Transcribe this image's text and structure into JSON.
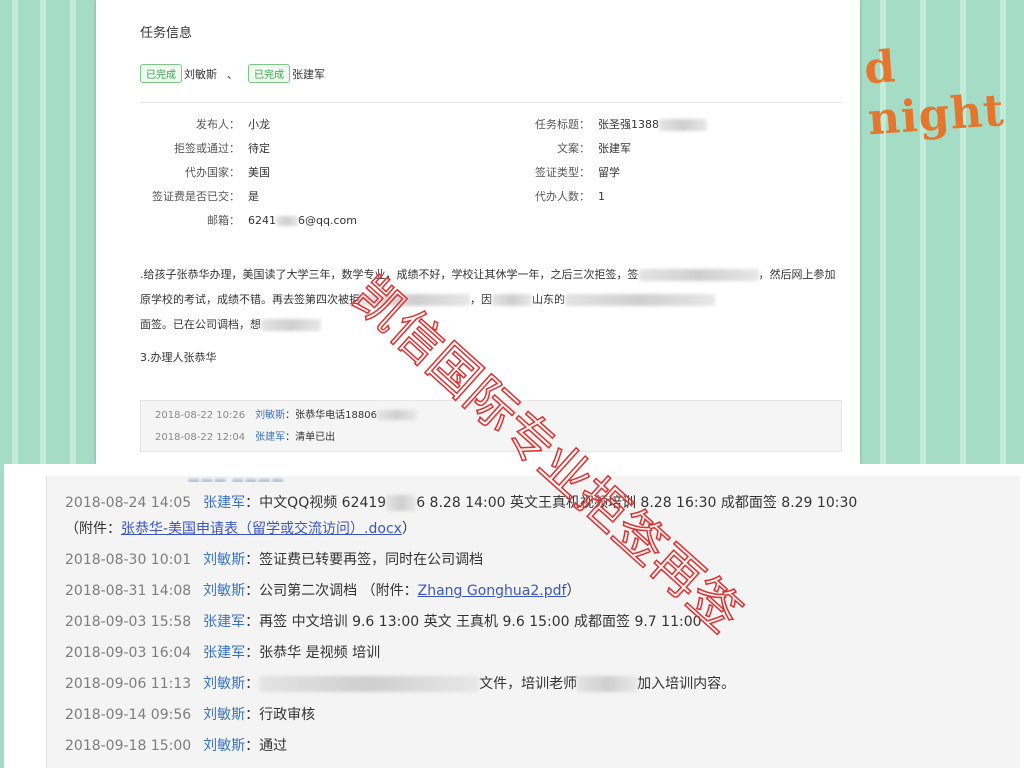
{
  "top": {
    "section_title": "任务信息",
    "assignees": [
      {
        "status": "已完成",
        "name": "刘敏斯"
      },
      {
        "status": "已完成",
        "name": "张建军"
      }
    ],
    "assignee_separator": "、",
    "fields": {
      "publisher_label": "发布人：",
      "publisher": "小龙",
      "refusal_label": "拒签或通过：",
      "refusal": "待定",
      "country_label": "代办国家：",
      "country": "美国",
      "fee_label": "签证费是否已交：",
      "fee": "是",
      "email_label": "邮箱：",
      "email_prefix": "6241",
      "email_suffix": "6@qq.com",
      "task_title_label": "任务标题：",
      "task_title": "张圣强1388",
      "copy_label": "文案：",
      "copy": "张建军",
      "visa_type_label": "签证类型：",
      "visa_type": "留学",
      "count_label": "代办人数：",
      "count": "1"
    },
    "description": [
      {
        "a": ".给孩子张恭华办理，美国读了大学三年，数学专业，成绩不好，学校让其休学一年，之后三次拒签，签",
        "b": "，然后网上参加"
      },
      {
        "a": "原学校的考试，成绩不错。再去签第四次被拒",
        "b": "，因",
        "c": "山东的"
      },
      {
        "a": "面签。已在公司调档，想"
      }
    ],
    "note": "3.办理人张恭华",
    "log": [
      {
        "date": "2018-08-22 10:26",
        "user": "刘敏斯",
        "msg": "：张恭华电话18806"
      },
      {
        "date": "2018-08-22 12:04",
        "user": "张建军",
        "msg": "：清单已出"
      }
    ]
  },
  "bottom": {
    "log": [
      {
        "date": "2018-08-24 14:05",
        "user": "张建军",
        "msg": "：中文QQ视频 62419",
        "msg2": "6 8.28 14:00 英文王真机视频培训 8.28 16:30 成都面签 8.29 10:30"
      },
      {
        "attach_prefix": "（附件：",
        "attach_link": "张恭华-美国申请表（留学或交流访问）.docx",
        "attach_suffix": "）"
      },
      {
        "date": "2018-08-30 10:01",
        "user": "刘敏斯",
        "msg": "：签证费已转要再签，同时在公司调档"
      },
      {
        "date": "2018-08-31 14:08",
        "user": "刘敏斯",
        "msg": "：公司第二次调档 （附件：",
        "link": "Zhang Gonghua2.pdf",
        "msg2": "）"
      },
      {
        "date": "2018-09-03 15:58",
        "user": "张建军",
        "msg": "：再签 中文培训 9.6 13:00 英文 王真机 9.6 15:00 成都面签 9.7 11:00"
      },
      {
        "date": "2018-09-03 16:04",
        "user": "张建军",
        "msg": "：张恭华 是视频 培训"
      },
      {
        "date": "2018-09-06 11:13",
        "user": "刘敏斯",
        "msg": "：",
        "msg2": "文件，培训老师",
        "msg3": "加入培训内容。"
      },
      {
        "date": "2018-09-14 09:56",
        "user": "刘敏斯",
        "msg": "：行政审核"
      },
      {
        "date": "2018-09-18 15:00",
        "user": "刘敏斯",
        "msg": "：通过"
      }
    ]
  },
  "decor": {
    "night": "d night",
    "watermark": "凯信国际专业拒签再签",
    "accent_color": "#e03030",
    "link_color": "#3a73c7"
  }
}
